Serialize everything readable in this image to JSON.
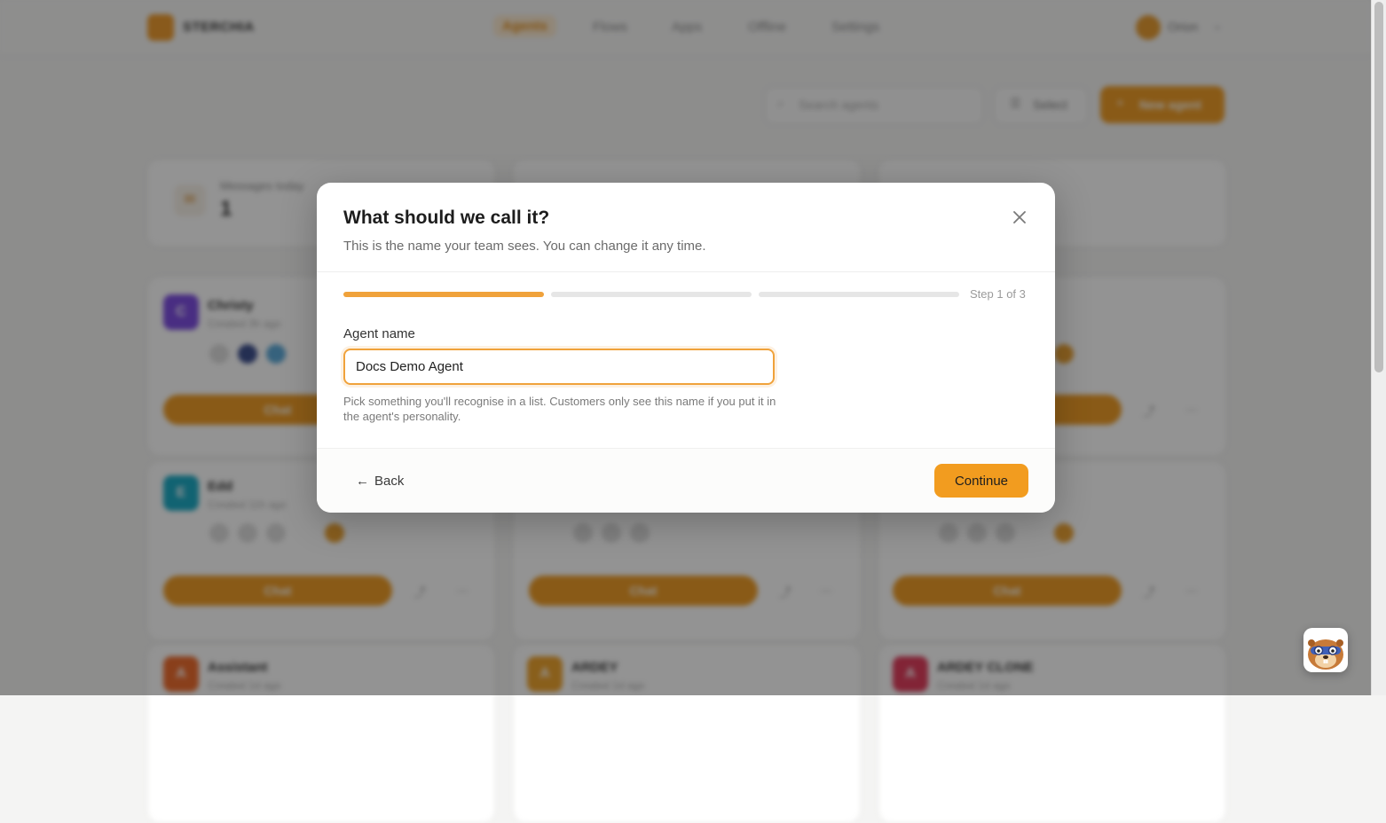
{
  "background": {
    "brand": "STERCHIA",
    "nav": [
      "Agents",
      "Flows",
      "Apps",
      "Offline",
      "Settings"
    ],
    "user_name": "Orion",
    "search_placeholder": "Search agents",
    "select_label": "Select",
    "new_agent_label": "New agent",
    "stat": {
      "label": "Messages today",
      "value": "1"
    },
    "agents": [
      {
        "initial": "C",
        "name": "Christy",
        "sub": "Created 3h ago",
        "action": "Chat",
        "color": "#7b4ae0"
      },
      {
        "initial": "E",
        "name": "Edd",
        "sub": "Created 11h ago",
        "action": "Chat",
        "color": "#18a9c4"
      },
      {
        "initial": "A",
        "name": "Assistant",
        "sub": "Created 1d ago",
        "action": "Chat",
        "color": "#ee6a2a"
      },
      {
        "initial": "A",
        "name": "ARDEY",
        "sub": "Created 1d ago",
        "action": "Chat",
        "color": "#eea22a"
      },
      {
        "initial": "A",
        "name": "ARDEY CLONE",
        "sub": "Created 1d ago",
        "action": "Chat",
        "color": "#e03a5a"
      }
    ]
  },
  "modal": {
    "title": "What should we call it?",
    "subtitle": "This is the name your team sees. You can change it any time.",
    "step_text": "Step 1 of 3",
    "progress": {
      "current_step": 1,
      "total_steps": 3
    },
    "field_label": "Agent name",
    "field_value": "Docs Demo Agent",
    "hint": "Pick something you'll recognise in a list. Customers only see this name if you put it in the agent's personality.",
    "back_label": "Back",
    "back_arrow": "←",
    "continue_label": "Continue"
  },
  "colors": {
    "accent": "#f29c1f",
    "progress_done": "#f0a23b",
    "progress_todo": "#e6e6e6"
  },
  "icons": {
    "close": "close-icon",
    "back": "arrow-left-icon",
    "mascot": "beaver-mascot-icon"
  }
}
